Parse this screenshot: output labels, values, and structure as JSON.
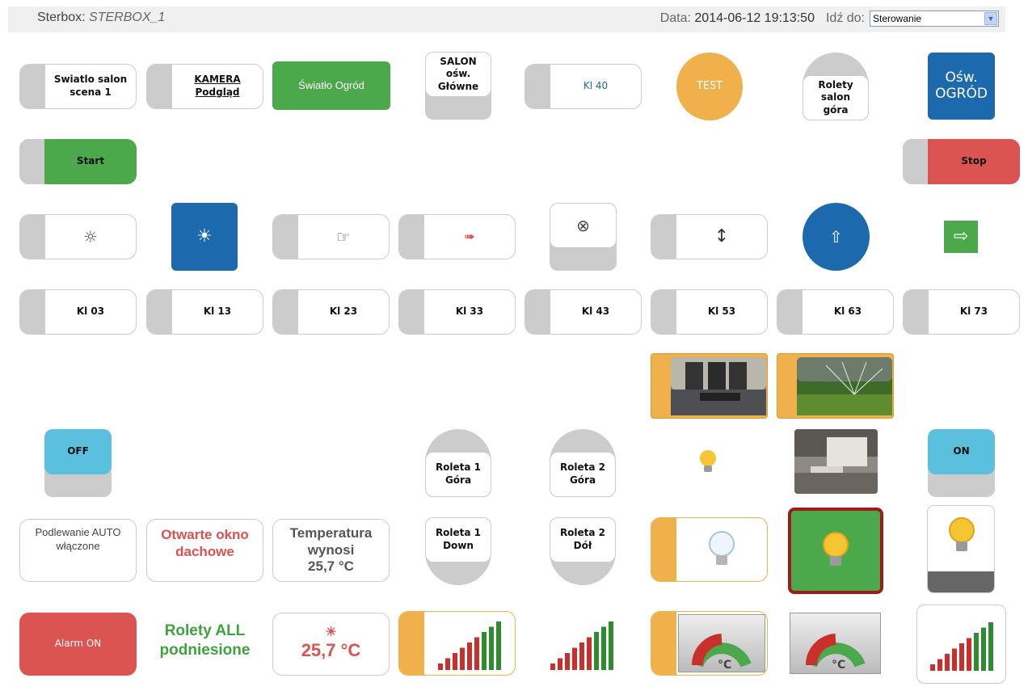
{
  "header": {
    "app": "Sterbox:",
    "device": "STERBOX_1",
    "date_label": "Data:",
    "datetime": "2014-06-12 19:13:50",
    "goto_label": "Idź do:",
    "goto_value": "Sterowanie"
  },
  "row1": {
    "swiatlo_salon": [
      "Swiatlo salon",
      "scena 1"
    ],
    "kamera": [
      "KAMERA",
      "Podgląd"
    ],
    "swiatlo_ogrod": "Światło Ogród",
    "salon_osw": [
      "SALON",
      "ośw.",
      "Główne"
    ],
    "kl40": "Kl 40",
    "test": "TEST",
    "rolety_salon": [
      "Rolety",
      "salon",
      "góra"
    ],
    "osw_ogrod": [
      "Ośw.",
      "OGRÓD"
    ]
  },
  "row2": {
    "start": "Start",
    "stop": "Stop"
  },
  "row3_icons": {
    "sun_outline": "☼",
    "sun": "☀",
    "hand": "☞",
    "arrow": "➠",
    "cross": "⊗",
    "updown": "↕",
    "up": "⇧",
    "right": "⇨"
  },
  "row4": [
    "Kl 03",
    "Kl 13",
    "Kl 23",
    "Kl 33",
    "Kl 43",
    "Kl 53",
    "Kl 63",
    "Kl 73"
  ],
  "row6": {
    "off": "OFF",
    "on": "ON",
    "roleta1_gora": [
      "Roleta 1",
      "Góra"
    ],
    "roleta2_gora": [
      "Roleta 2",
      "Góra"
    ]
  },
  "row7": {
    "podlewanie": [
      "Podlewanie AUTO",
      "włączone"
    ],
    "okno": [
      "Otwarte okno",
      "dachowe"
    ],
    "temp": [
      "Temperatura",
      "wynosi",
      "25,7 °C"
    ],
    "roleta1_down": [
      "Roleta 1",
      "Down"
    ],
    "roleta2_dol": [
      "Roleta 2",
      "Dół"
    ]
  },
  "row8": {
    "alarm": "Alarm ON",
    "rolety_all": [
      "Rolety ALL",
      "podniesione"
    ],
    "temp_big": "25,7 °C",
    "gauge_unit": "°C"
  },
  "colors": {
    "green": "#4ba84b",
    "red": "#dc5452",
    "blue": "#1c6aad",
    "lightblue": "#5bc0de",
    "orange": "#f0b04c",
    "gray": "#cccccc",
    "text_red": "#d9534f",
    "text_green": "#3ea33e"
  }
}
